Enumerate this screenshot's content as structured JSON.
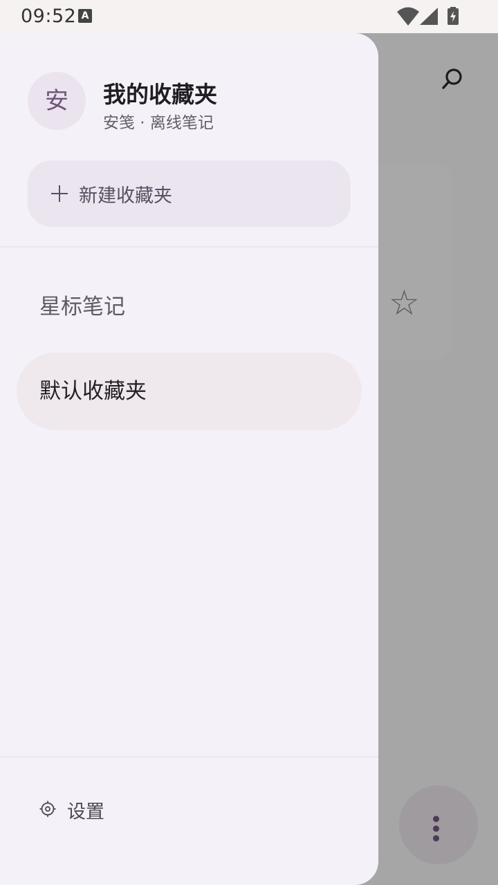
{
  "status_bar": {
    "time": "09:52",
    "notification_icon": "A"
  },
  "drawer": {
    "avatar_text": "安",
    "title": "我的收藏夹",
    "subtitle": "安笺 · 离线笔记",
    "new_folder_label": "新建收藏夹",
    "items": [
      {
        "label": "星标笔记",
        "selected": false
      },
      {
        "label": "默认收藏夹",
        "selected": true
      }
    ],
    "settings_label": "设置"
  },
  "background": {
    "star_glyph": "☆"
  },
  "icons": {
    "search": "search-icon",
    "plus": "plus-icon",
    "settings": "gear-icon",
    "more": "more-vert-icon",
    "star": "star-outline-icon"
  },
  "colors": {
    "accent": "#6d5579",
    "scrim": "#a6a6a6",
    "drawer_bg": "#f5f1f8"
  }
}
